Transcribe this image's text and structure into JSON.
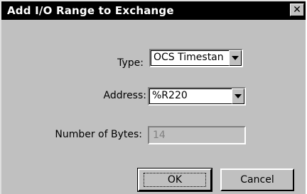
{
  "dialog": {
    "title": "Add I/O Range to Exchange",
    "close_glyph": "✕"
  },
  "fields": {
    "type_label": "Type:",
    "type_value": "OCS Timestan",
    "address_label": "Address:",
    "address_value": "%R220",
    "bytes_label": "Number of Bytes:",
    "bytes_value": "14"
  },
  "buttons": {
    "ok_label": "OK",
    "cancel_label": "Cancel"
  }
}
